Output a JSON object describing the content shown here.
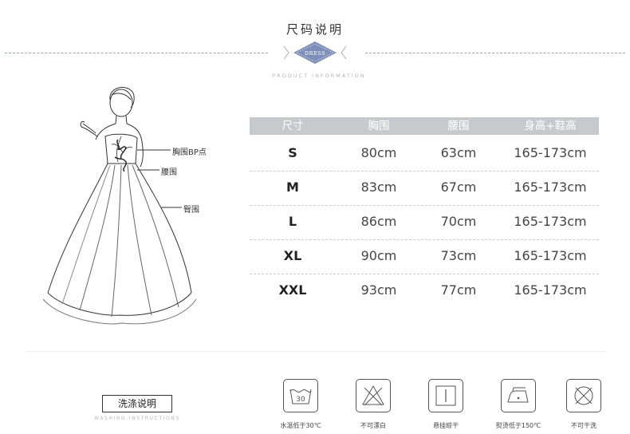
{
  "header": {
    "title": "尺码说明",
    "badge": "DRESS",
    "subtitle": "PRODUCT INFORMATION"
  },
  "figure": {
    "callouts": [
      "胸围BP点",
      "腰围",
      "臀围"
    ]
  },
  "size_table": {
    "headers": [
      "尺寸",
      "胸围",
      "腰围",
      "身高+鞋高"
    ],
    "rows": [
      [
        "S",
        "80cm",
        "63cm",
        "165-173cm"
      ],
      [
        "M",
        "83cm",
        "67cm",
        "165-173cm"
      ],
      [
        "L",
        "86cm",
        "70cm",
        "165-173cm"
      ],
      [
        "XL",
        "90cm",
        "73cm",
        "165-173cm"
      ],
      [
        "XXL",
        "93cm",
        "77cm",
        "165-173cm"
      ]
    ],
    "header_color": "#c8c9cc"
  },
  "washing": {
    "title": "洗涤说明",
    "subtitle": "WASHING INSTRUCTIONS",
    "icons": [
      {
        "icon": "wash-30-icon",
        "label": "水温低于30℃",
        "number": "30"
      },
      {
        "icon": "no-bleach-icon",
        "label": "不可漂白"
      },
      {
        "icon": "hang-dry-icon",
        "label": "悬挂晾干"
      },
      {
        "icon": "iron-icon",
        "label": "熨烫低于150℃"
      },
      {
        "icon": "no-dry-clean-icon",
        "label": "不可干洗"
      }
    ]
  }
}
